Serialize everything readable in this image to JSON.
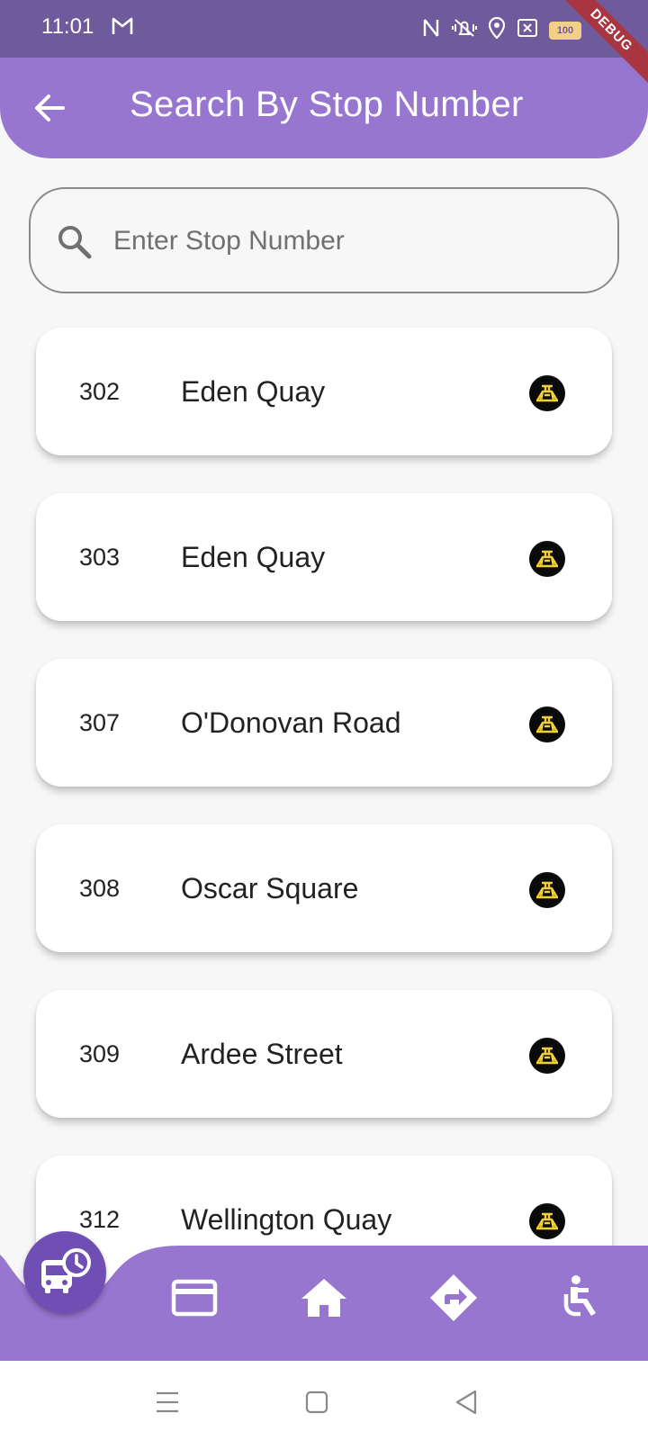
{
  "status_bar": {
    "time": "11:01",
    "battery": "100",
    "debug_banner": "DEBUG",
    "icons": [
      "gmail-icon",
      "nfc-icon",
      "vibrate-icon",
      "location-icon",
      "close-box-icon",
      "battery-icon"
    ]
  },
  "app_bar": {
    "title": "Search By Stop Number",
    "back_icon": "arrow-left-icon"
  },
  "search": {
    "placeholder": "Enter Stop Number",
    "value": ""
  },
  "stops": [
    {
      "number": "302",
      "name": "Eden Quay"
    },
    {
      "number": "303",
      "name": "Eden Quay"
    },
    {
      "number": "307",
      "name": "O'Donovan Road"
    },
    {
      "number": "308",
      "name": "Oscar Square"
    },
    {
      "number": "309",
      "name": "Ardee Street"
    },
    {
      "number": "312",
      "name": "Wellington Quay"
    }
  ],
  "bottom_nav": {
    "items": [
      "bus-clock-icon",
      "card-icon",
      "home-icon",
      "directions-icon",
      "accessible-icon"
    ],
    "active": "bus-clock-icon"
  },
  "colors": {
    "primary": "#9776cf",
    "status_bar": "#6f5a9b",
    "fab": "#6f4fb3",
    "operator_logo_bg": "#0a0a0a",
    "operator_logo_fg": "#f2d230"
  }
}
